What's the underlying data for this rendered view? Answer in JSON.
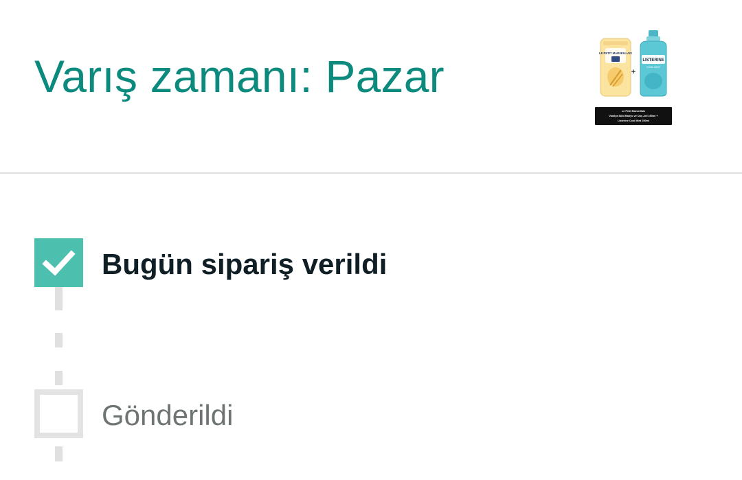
{
  "header": {
    "arrival_title": "Varış zamanı: Pazar"
  },
  "product": {
    "left_brand": "LE PETIT MARSEILLAIS",
    "right_brand": "LISTERINE",
    "right_subtitle": "COOL MINT",
    "caption_line1": "Le Petit Marseillais",
    "caption_line2": "Vanilya Sütü Banyo ve Duş Jeli 250ml +",
    "caption_line3": "Listerine Cool Mint 250ml"
  },
  "tracking": {
    "steps": [
      {
        "label": "Bugün sipariş verildi",
        "status": "done"
      },
      {
        "label": "Gönderildi",
        "status": "pending"
      }
    ]
  },
  "colors": {
    "accent": "#0b8a7d",
    "check_fill": "#4dbfae",
    "pending_border": "#e3e3e3",
    "divider": "#dedede"
  }
}
